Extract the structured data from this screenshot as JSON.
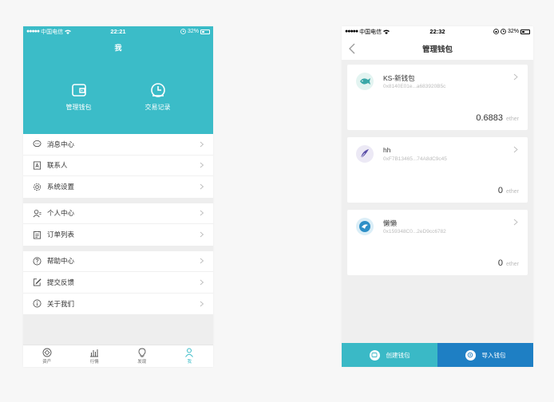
{
  "left": {
    "status": {
      "carrier": "中国电信",
      "time": "22:21",
      "battery": "32%"
    },
    "title": "我",
    "actions": [
      {
        "label": "管理钱包",
        "icon": "wallet-icon"
      },
      {
        "label": "交易记录",
        "icon": "clock-icon"
      }
    ],
    "groups": [
      [
        {
          "label": "消息中心",
          "icon": "message-icon"
        },
        {
          "label": "联系人",
          "icon": "contact-icon"
        },
        {
          "label": "系统设置",
          "icon": "gear-icon"
        }
      ],
      [
        {
          "label": "个人中心",
          "icon": "user-icon"
        },
        {
          "label": "订单列表",
          "icon": "clipboard-icon"
        }
      ],
      [
        {
          "label": "帮助中心",
          "icon": "help-icon"
        },
        {
          "label": "提交反馈",
          "icon": "edit-icon"
        },
        {
          "label": "关于我们",
          "icon": "info-icon"
        }
      ]
    ],
    "tabs": [
      {
        "label": "资产",
        "icon": "asset-icon",
        "active": false
      },
      {
        "label": "行情",
        "icon": "chart-icon",
        "active": false
      },
      {
        "label": "发现",
        "icon": "bulb-icon",
        "active": false
      },
      {
        "label": "我",
        "icon": "person-icon",
        "active": true
      }
    ],
    "accent": "#3bbcc8"
  },
  "right": {
    "status": {
      "carrier": "中国电信",
      "time": "22:32",
      "battery": "32%"
    },
    "title": "管理钱包",
    "wallets": [
      {
        "name": "KS-新钱包",
        "address": "0x8140E01e...a683920B5c",
        "amount": "0.6883",
        "unit": "ether",
        "avatar_color": "#e3f4f1"
      },
      {
        "name": "hh",
        "address": "0xF7B13465...74A8dC9c45",
        "amount": "0",
        "unit": "ether",
        "avatar_color": "#ece9f5"
      },
      {
        "name": "懒懒",
        "address": "0x159348C0...2eD9cc6782",
        "amount": "0",
        "unit": "ether",
        "avatar_color": "#dbeef7"
      }
    ],
    "buttons": {
      "create": "创建钱包",
      "import": "导入钱包"
    },
    "colors": {
      "create": "#3ab9c6",
      "import": "#1e7fc4"
    }
  }
}
